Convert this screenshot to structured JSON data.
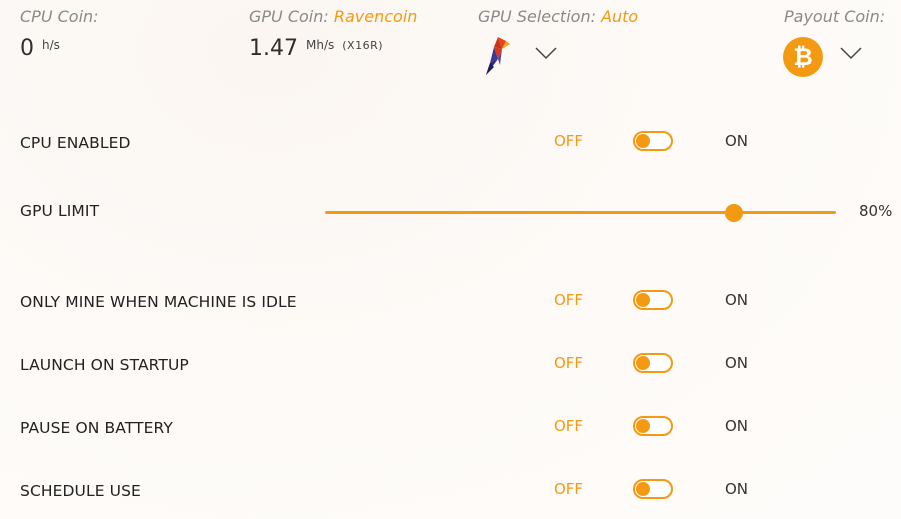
{
  "header": {
    "cpu_coin": {
      "label": "CPU Coin:",
      "value": "0",
      "unit": "h/s"
    },
    "gpu_coin": {
      "label": "GPU Coin:",
      "coin": "Ravencoin",
      "value": "1.47",
      "unit": "Mh/s",
      "algo": "(X16R)"
    },
    "gpu_selection": {
      "label": "GPU Selection:",
      "value": "Auto",
      "icon": "ravencoin-logo-icon"
    },
    "payout_coin": {
      "label": "Payout Coin:",
      "icon": "bitcoin-icon",
      "symbol": "₿"
    }
  },
  "settings": {
    "off_label": "OFF",
    "on_label": "ON",
    "cpu_enabled": {
      "label": "CPU ENABLED",
      "enabled": false
    },
    "gpu_limit": {
      "label": "GPU LIMIT",
      "value": 80,
      "display": "80%"
    },
    "idle_only": {
      "label": "ONLY MINE WHEN MACHINE IS IDLE",
      "enabled": false
    },
    "launch_startup": {
      "label": "LAUNCH ON STARTUP",
      "enabled": false
    },
    "pause_battery": {
      "label": "PAUSE ON BATTERY",
      "enabled": false
    },
    "schedule_use": {
      "label": "SCHEDULE USE",
      "enabled": false
    }
  },
  "colors": {
    "accent": "#f39a12",
    "text": "#222222",
    "muted": "#8a8a8a"
  }
}
